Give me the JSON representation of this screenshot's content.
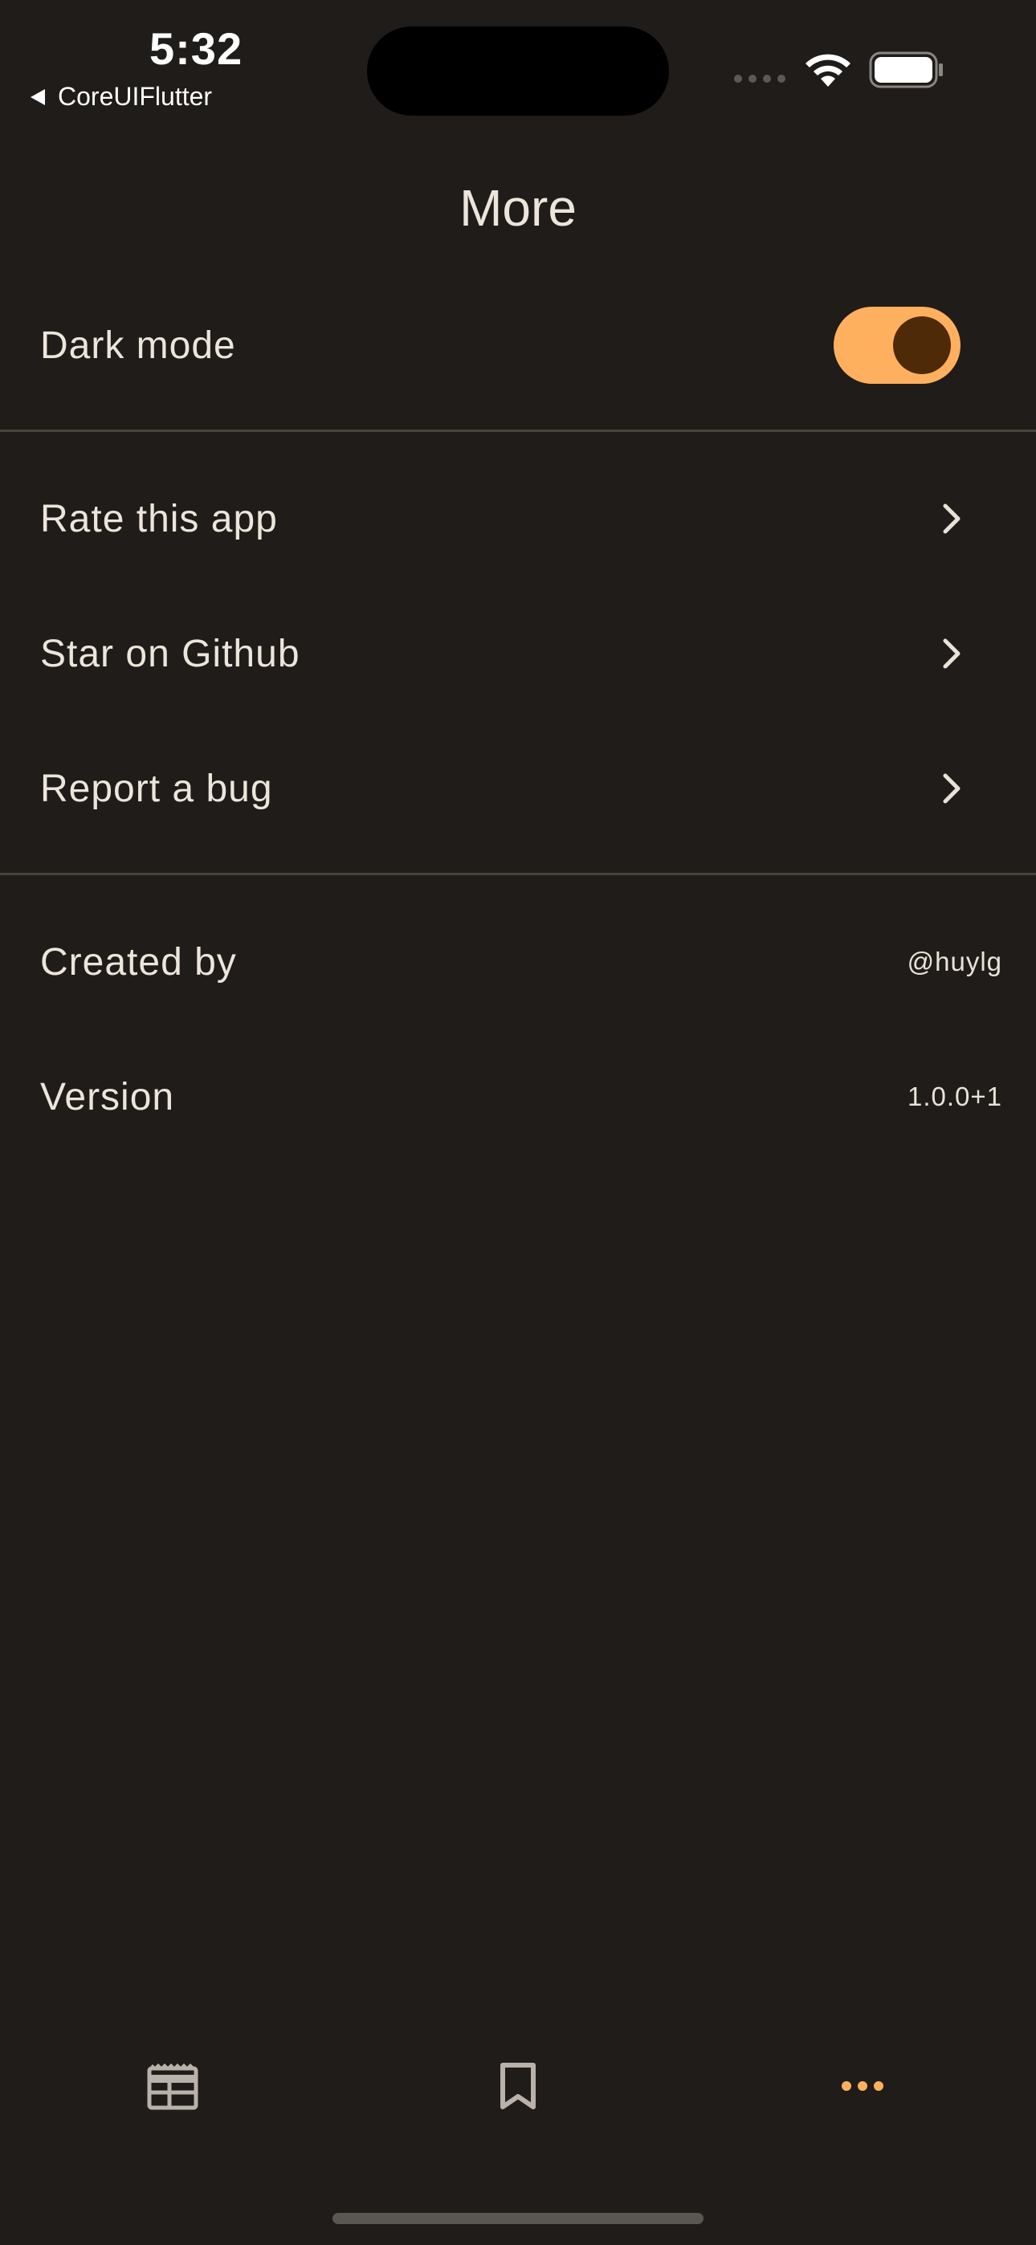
{
  "status_bar": {
    "time": "5:32",
    "back_app_label": "CoreUIFlutter"
  },
  "header": {
    "title": "More"
  },
  "settings": {
    "dark_mode": {
      "label": "Dark mode",
      "enabled": true
    },
    "links": [
      {
        "label": "Rate this app",
        "icon": "chevron-right-icon"
      },
      {
        "label": "Star on Github",
        "icon": "chevron-right-icon"
      },
      {
        "label": "Report a bug",
        "icon": "chevron-right-icon"
      }
    ],
    "info": [
      {
        "label": "Created by",
        "value": "@huylg"
      },
      {
        "label": "Version",
        "value": "1.0.0+1"
      }
    ]
  },
  "bottom_nav": {
    "items": [
      {
        "icon": "feed-icon",
        "active": false
      },
      {
        "icon": "bookmark-icon",
        "active": false
      },
      {
        "icon": "more-dots-icon",
        "active": true
      }
    ]
  },
  "colors": {
    "background": "#1f1c19",
    "accent": "#ffb05f",
    "toggle_knob": "#4f2a08",
    "divider": "#4a433b",
    "text": "#ece5db",
    "inactive_icon": "#b9b2aa"
  }
}
